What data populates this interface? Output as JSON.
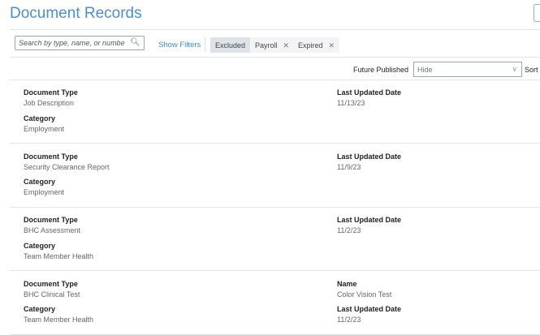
{
  "header": {
    "title": "Document Records"
  },
  "toolbar": {
    "search_placeholder": "Search by type, name, or numbe",
    "show_filters": "Show Filters",
    "chips": [
      {
        "label": "Excluded",
        "removable": false
      },
      {
        "label": "Payroll",
        "removable": true
      },
      {
        "label": "Expired",
        "removable": true
      }
    ],
    "close_glyph": "✕"
  },
  "options": {
    "future_published_label": "Future Published",
    "future_published_value": "Hide",
    "sort_label": "Sort"
  },
  "records": [
    {
      "fields_left": [
        {
          "label": "Document Type",
          "value": "Job Description"
        },
        {
          "label": "Category",
          "value": "Employment"
        }
      ],
      "fields_right": [
        {
          "label": "Last Updated Date",
          "value": "11/13/23"
        }
      ]
    },
    {
      "fields_left": [
        {
          "label": "Document Type",
          "value": "Security Clearance Report"
        },
        {
          "label": "Category",
          "value": "Employment"
        }
      ],
      "fields_right": [
        {
          "label": "Last Updated Date",
          "value": "11/9/23"
        }
      ]
    },
    {
      "fields_left": [
        {
          "label": "Document Type",
          "value": "BHC Assessment"
        },
        {
          "label": "Category",
          "value": "Team Member Health"
        }
      ],
      "fields_right": [
        {
          "label": "Last Updated Date",
          "value": "11/2/23"
        }
      ]
    },
    {
      "fields_left": [
        {
          "label": "Document Type",
          "value": "BHC Clinical Test"
        },
        {
          "label": "Category",
          "value": "Team Member Health"
        }
      ],
      "fields_right": [
        {
          "label": "Name",
          "value": "Color Vision Test"
        },
        {
          "label": "Last Updated Date",
          "value": "11/2/23"
        }
      ]
    }
  ]
}
